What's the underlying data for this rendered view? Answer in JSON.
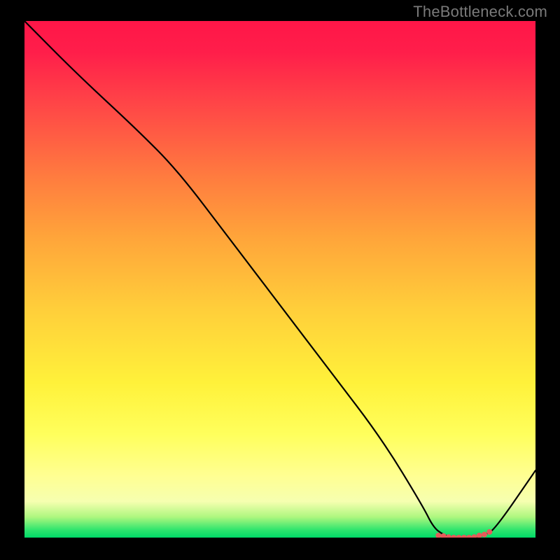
{
  "watermark": "TheBottleneck.com",
  "chart_data": {
    "type": "line",
    "title": "",
    "xlabel": "",
    "ylabel": "",
    "xlim": [
      0,
      100
    ],
    "ylim": [
      0,
      100
    ],
    "x": [
      0,
      10,
      22,
      30,
      40,
      50,
      60,
      70,
      78,
      80,
      82,
      84,
      86,
      88,
      90,
      92,
      100
    ],
    "values": [
      100,
      90,
      79,
      71,
      58,
      45,
      32,
      19,
      6,
      2,
      0.5,
      0,
      0,
      0,
      0.5,
      1.5,
      13
    ],
    "markers_x": [
      81,
      82,
      83,
      84,
      85,
      86,
      87,
      88,
      89,
      90,
      91
    ],
    "markers_y": [
      0.4,
      0.3,
      0.1,
      0,
      0,
      0,
      0,
      0.1,
      0.4,
      0.6,
      1.1
    ]
  }
}
